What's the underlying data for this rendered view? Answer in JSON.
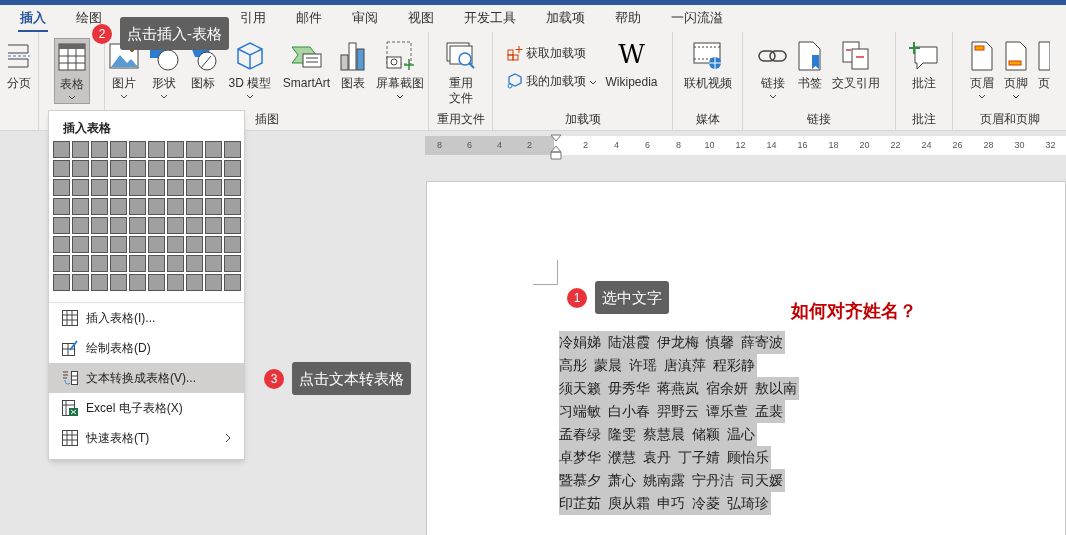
{
  "ribbon_tabs": [
    {
      "label": "插入",
      "selected": true
    },
    {
      "label": "绘图",
      "selected": false
    },
    {
      "label": "引用",
      "selected": false
    },
    {
      "label": "邮件",
      "selected": false
    },
    {
      "label": "审阅",
      "selected": false
    },
    {
      "label": "视图",
      "selected": false
    },
    {
      "label": "开发工具",
      "selected": false
    },
    {
      "label": "加载项",
      "selected": false
    },
    {
      "label": "帮助",
      "selected": false
    },
    {
      "label": "一闪流溢",
      "selected": false
    }
  ],
  "ribbon_groups": [
    {
      "items": [
        {
          "label": "分页",
          "kind": "large",
          "pressed": false,
          "dropdown": false
        }
      ]
    },
    {
      "items": [
        {
          "label": "表格",
          "kind": "large",
          "pressed": true,
          "dropdown": true
        }
      ]
    },
    {
      "label": "插图",
      "items": [
        {
          "label": "图片",
          "kind": "large",
          "pressed": false,
          "dropdown": true
        },
        {
          "label": "形状",
          "kind": "large",
          "pressed": false,
          "dropdown": true
        },
        {
          "label": "图标",
          "kind": "large",
          "pressed": false,
          "dropdown": false
        },
        {
          "label": "3D 模型",
          "kind": "large",
          "pressed": false,
          "dropdown": true
        },
        {
          "label": "SmartArt",
          "kind": "large",
          "pressed": false,
          "dropdown": false
        },
        {
          "label": "图表",
          "kind": "large",
          "pressed": false,
          "dropdown": false
        },
        {
          "label": "屏幕截图",
          "kind": "large",
          "pressed": false,
          "dropdown": true
        }
      ]
    },
    {
      "label": "重用文件",
      "items": [
        {
          "label": "重用文件",
          "kind": "large",
          "pressed": false,
          "dropdown": false
        }
      ]
    },
    {
      "label": "加载项",
      "items": [
        {
          "label": "获取加载项",
          "kind": "small",
          "pressed": false,
          "dropdown": false
        },
        {
          "label": "我的加载项",
          "kind": "small",
          "pressed": false,
          "dropdown": true
        },
        {
          "label": "Wikipedia",
          "logo_text": "W",
          "kind": "logo",
          "pressed": false,
          "dropdown": false
        }
      ]
    },
    {
      "label": "媒体",
      "items": [
        {
          "label": "联机视频",
          "kind": "large",
          "pressed": false,
          "dropdown": false
        }
      ]
    },
    {
      "label": "链接",
      "items": [
        {
          "label": "链接",
          "kind": "large",
          "pressed": false,
          "dropdown": true
        },
        {
          "label": "书签",
          "kind": "large",
          "pressed": false,
          "dropdown": false
        },
        {
          "label": "交叉引用",
          "kind": "large",
          "pressed": false,
          "dropdown": false
        }
      ]
    },
    {
      "label": "批注",
      "items": [
        {
          "label": "批注",
          "kind": "large",
          "pressed": false,
          "dropdown": false
        }
      ]
    },
    {
      "label": "页眉和页脚",
      "items": [
        {
          "label": "页眉",
          "kind": "large",
          "pressed": false,
          "dropdown": true
        },
        {
          "label": "页脚",
          "kind": "large",
          "pressed": false,
          "dropdown": true
        },
        {
          "label": "页",
          "kind": "large",
          "pressed": false,
          "dropdown": false
        }
      ]
    }
  ],
  "table_menu": {
    "title": "插入表格",
    "items": [
      {
        "label": "插入表格(I)...",
        "highlighted": false,
        "submenu": false
      },
      {
        "label": "绘制表格(D)",
        "highlighted": false,
        "submenu": false
      },
      {
        "label": "文本转换成表格(V)...",
        "highlighted": true,
        "submenu": false
      },
      {
        "label": "Excel 电子表格(X)",
        "highlighted": false,
        "submenu": false
      },
      {
        "label": "快速表格(T)",
        "highlighted": false,
        "submenu": true
      }
    ]
  },
  "ruler": {
    "left_marks": [
      "8",
      "6",
      "4",
      "2"
    ],
    "right_marks": [
      "2",
      "4",
      "6",
      "8",
      "10",
      "12",
      "14",
      "16",
      "18",
      "20",
      "22",
      "24",
      "26",
      "28",
      "30",
      "32"
    ]
  },
  "document": {
    "heading": "如何对齐姓名？",
    "name_lines": [
      "冷娟娣 陆湛霞 伊龙梅 慎馨 薛寄波",
      "高彤 蒙晨 许瑶 唐滇萍 程彩静",
      "须天籁 毋秀华 蒋燕岚 宿余妍 敖以南",
      "习端敏 白小春 羿野云 谭乐萱 孟裴",
      "孟春绿 隆雯 蔡慧晨 储颖 温心",
      "卓梦华 濮慧 袁丹 丁子婧 顾怡乐",
      "暨慕夕 萧心 姚南露 宁丹洁 司天媛",
      "印芷茹 庾从霜 申巧 冷菱 弘琦珍"
    ]
  },
  "callouts": [
    {
      "number": "2",
      "text": "点击插入-表格"
    },
    {
      "number": "1",
      "text": "选中文字"
    },
    {
      "number": "3",
      "text": "点击文本转表格"
    }
  ]
}
